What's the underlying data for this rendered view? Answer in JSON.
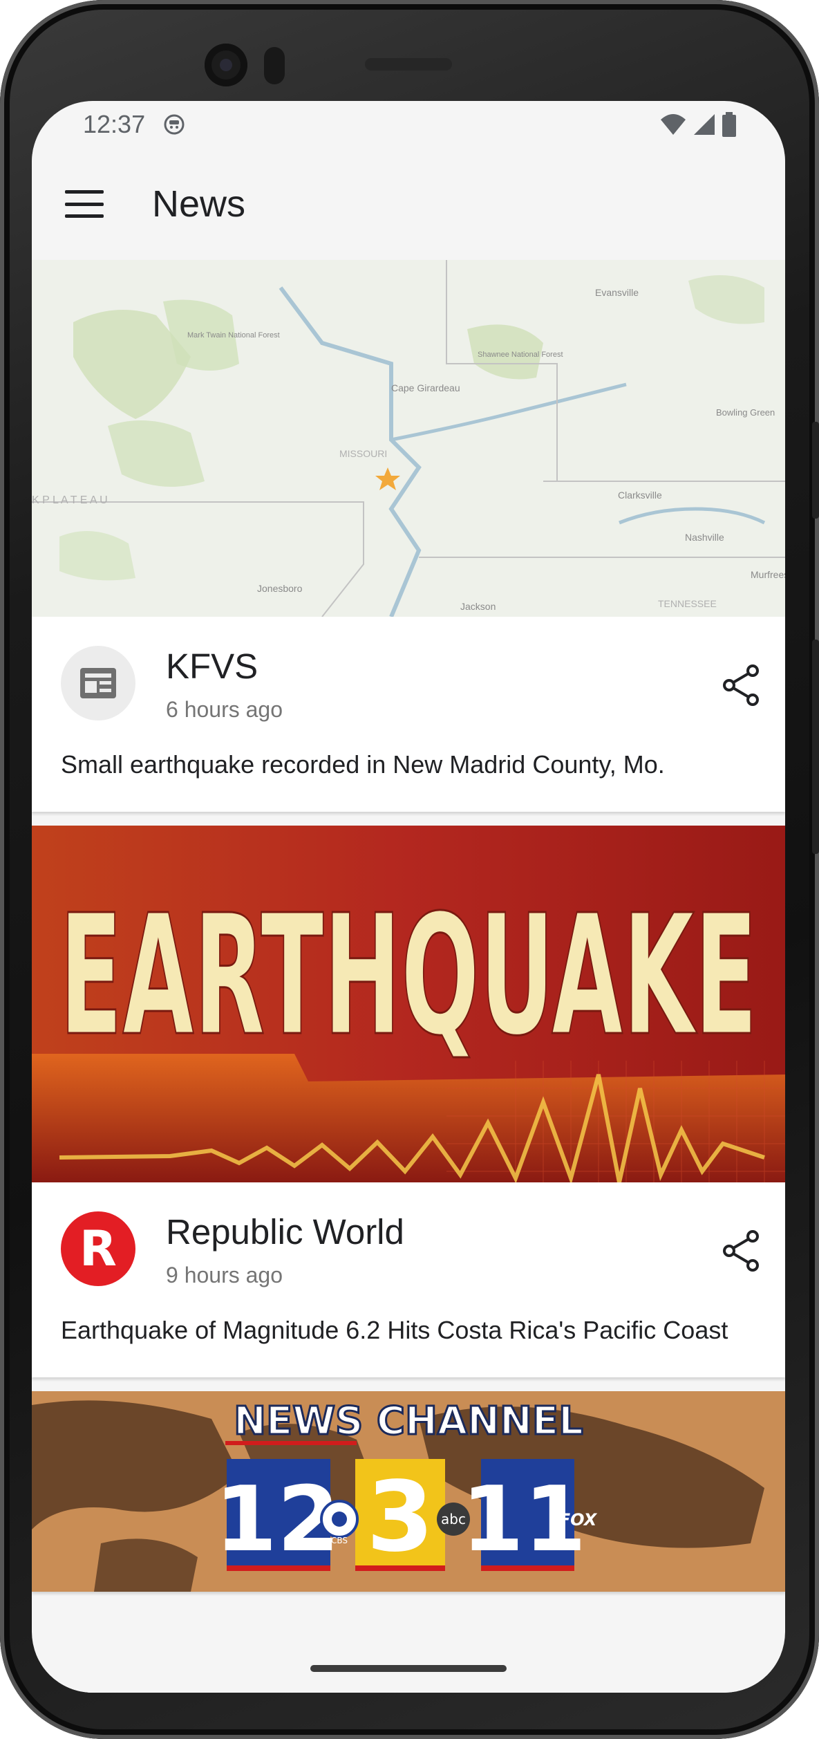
{
  "status_bar": {
    "time": "12:37"
  },
  "app_bar": {
    "title": "News",
    "menu_icon": "hamburger-menu-icon"
  },
  "articles": [
    {
      "source": "KFVS",
      "time_ago": "6 hours ago",
      "headline": "Small earthquake recorded in New Madrid County, Mo.",
      "image": "map",
      "map_labels": {
        "evansville": "Evansville",
        "mark_twain": "Mark Twain National Forest",
        "shawnee": "Shawnee National Forest",
        "cape": "Cape Girardeau",
        "bowling": "Bowling Green",
        "missouri": "MISSOURI",
        "plateau": "K  P L A T E A U",
        "clarksville": "Clarksville",
        "nashville": "Nashville",
        "murfreesboro": "Murfreesbo",
        "jonesboro": "Jonesboro",
        "jackson": "Jackson",
        "tennessee": "TENNESSEE"
      }
    },
    {
      "source": "Republic World",
      "time_ago": "9 hours ago",
      "headline": "Earthquake of Magnitude 6.2 Hits Costa Rica's Pacific Coast",
      "image": "earthquake-banner",
      "banner_text": "EARTHQUAKE",
      "avatar_letter": "R"
    },
    {
      "image": "news-channel-banner",
      "banner_title": "NEWS CHANNEL",
      "channels": [
        "12",
        "3",
        "11"
      ],
      "networks": [
        "CBS",
        "abc",
        "FOX"
      ]
    }
  ],
  "colors": {
    "avatar_red": "#e31e24",
    "banner_red": "#b3271f",
    "banner_cream": "#f6e9b5",
    "channel_blue": "#1f3f9a",
    "channel_yellow": "#f2c41a"
  }
}
